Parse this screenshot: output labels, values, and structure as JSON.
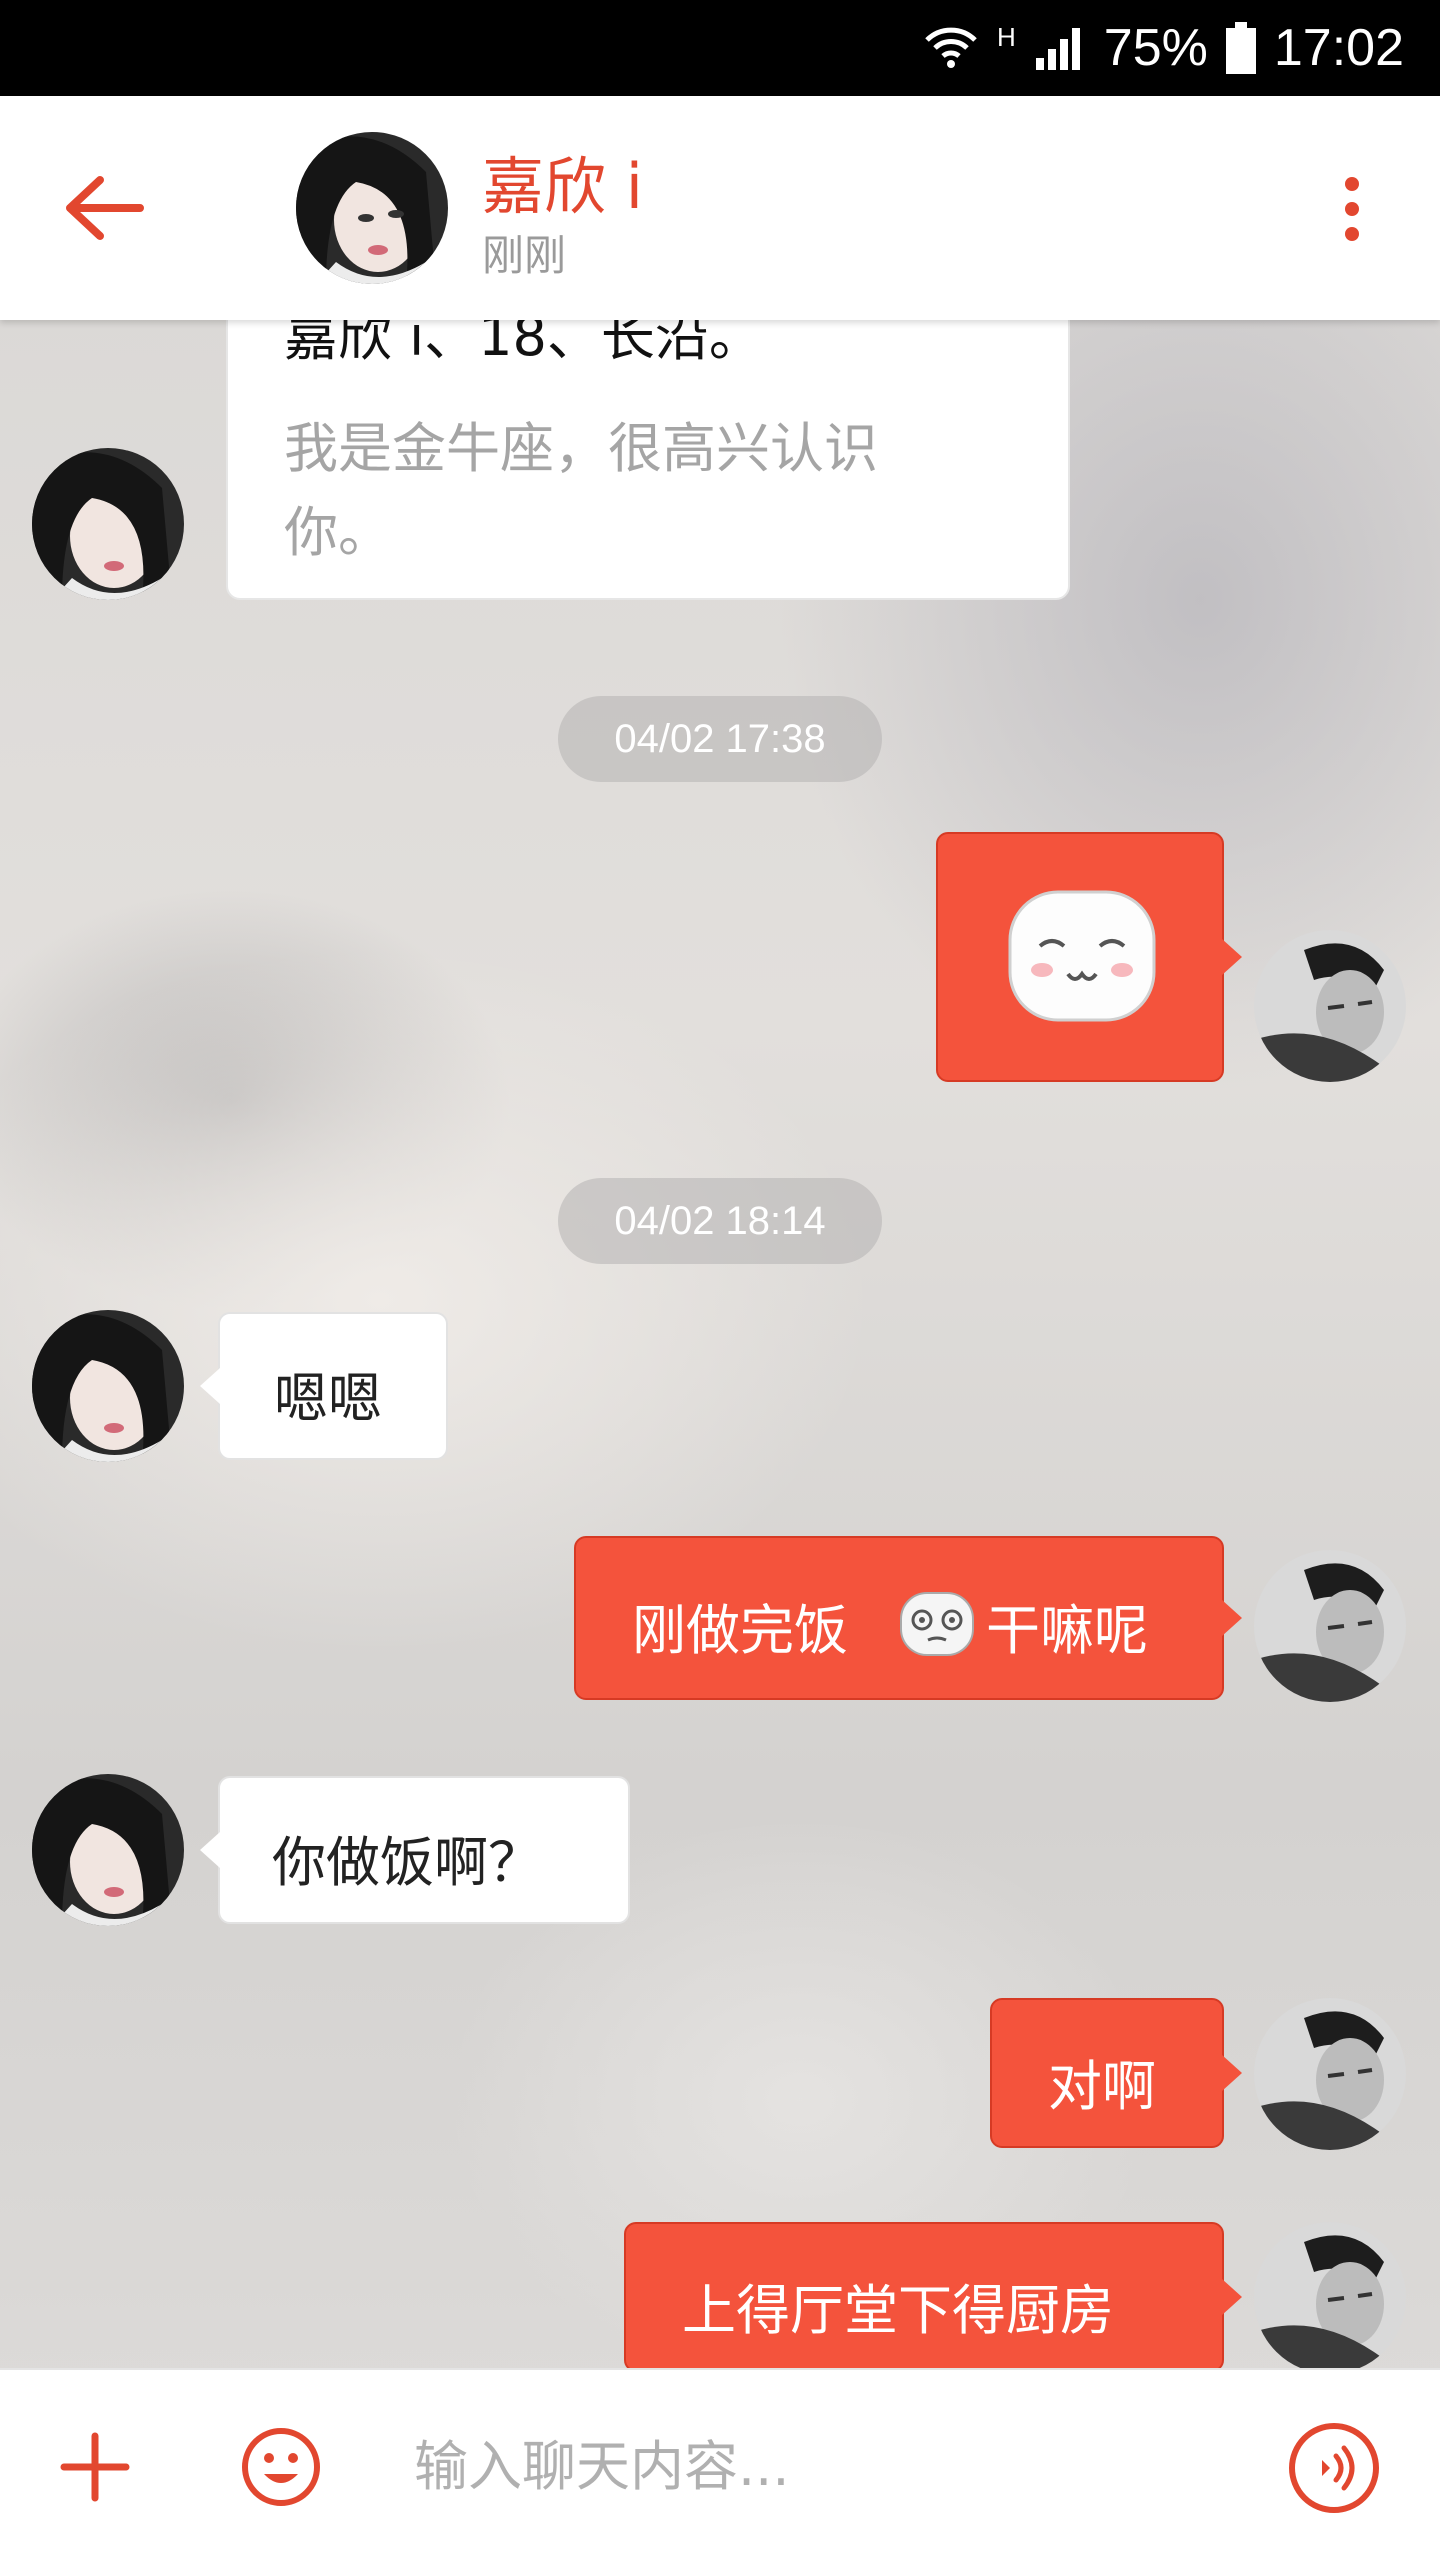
{
  "status_bar": {
    "network_type": "H",
    "battery_percent": "75%",
    "time": "17:02"
  },
  "header": {
    "contact_name": "嘉欣 i",
    "contact_status": "刚刚",
    "accent_color": "#e2472f"
  },
  "messages": {
    "intro_card": {
      "line1": "嘉欣 i、18、长沿。",
      "line2": "我是金牛座，很高兴认识你。"
    },
    "timestamp1": "04/02 17:38",
    "sticker_message": "smiling-face-sticker",
    "timestamp2": "04/02 18:14",
    "msg_in_1": "嗯嗯",
    "msg_out_1_before": "刚做完饭",
    "msg_out_1_emoji": "dizzy-face-emoji",
    "msg_out_1_after": "干嘛呢",
    "msg_in_2": "你做饭啊？",
    "msg_out_2": "对啊",
    "msg_out_3": "上得厅堂下得厨房"
  },
  "input_bar": {
    "placeholder": "输入聊天内容..."
  },
  "colors": {
    "outgoing_bubble": "#f4533c",
    "incoming_bubble": "#ffffff"
  }
}
